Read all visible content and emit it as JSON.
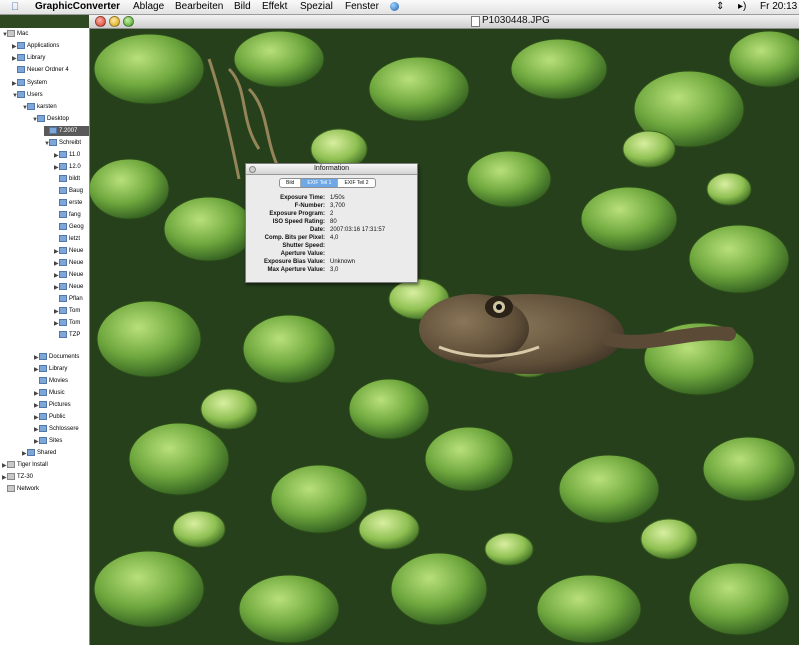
{
  "menubar": {
    "app_name": "GraphicConverter",
    "menus": [
      "Ablage",
      "Bearbeiten",
      "Bild",
      "Effekt",
      "Spezial",
      "Fenster"
    ],
    "clock": "Fr 20:13"
  },
  "window": {
    "title": "P1030448.JPG"
  },
  "sidebar": {
    "items": [
      {
        "label": "Mac"
      },
      {
        "label": "Applications"
      },
      {
        "label": "Library"
      },
      {
        "label": "Neuer Ordner 4"
      },
      {
        "label": "System"
      },
      {
        "label": "Users"
      },
      {
        "label": "karsten"
      },
      {
        "label": "Desktop"
      },
      {
        "label": "7.2007"
      },
      {
        "label": "Schreibt"
      },
      {
        "label": "11.0"
      },
      {
        "label": "12.0"
      },
      {
        "label": "bildt"
      },
      {
        "label": "Baug"
      },
      {
        "label": "erste"
      },
      {
        "label": "fang"
      },
      {
        "label": "Geog"
      },
      {
        "label": "letzt"
      },
      {
        "label": "Neue"
      },
      {
        "label": "Neue"
      },
      {
        "label": "Neue"
      },
      {
        "label": "Neue"
      },
      {
        "label": "Pflan"
      },
      {
        "label": "Tom"
      },
      {
        "label": "Tom"
      },
      {
        "label": "TZP"
      },
      {
        "label": "Documents"
      },
      {
        "label": "Library"
      },
      {
        "label": "Movies"
      },
      {
        "label": "Music"
      },
      {
        "label": "Pictures"
      },
      {
        "label": "Public"
      },
      {
        "label": "Schlossere"
      },
      {
        "label": "Sites"
      },
      {
        "label": "Shared"
      },
      {
        "label": "Tiger Install"
      },
      {
        "label": "TZ-30"
      },
      {
        "label": "Network"
      }
    ]
  },
  "info_panel": {
    "title": "Information",
    "tabs": [
      "Bild",
      "EXIF Teil 1",
      "EXIF Teil 2"
    ],
    "active_tab": "EXIF Teil 1",
    "rows": [
      {
        "key": "Exposure Time:",
        "value": "1/50s"
      },
      {
        "key": "F-Number:",
        "value": "3,700"
      },
      {
        "key": "Exposure Program:",
        "value": "2"
      },
      {
        "key": "ISO Speed Rating:",
        "value": "80"
      },
      {
        "key": "Date:",
        "value": "2007:03:16 17:31:57"
      },
      {
        "key": "Comp. Bits per Pixel:",
        "value": "4,0"
      },
      {
        "key": "Shutter Speed:",
        "value": ""
      },
      {
        "key": "Aperture Value:",
        "value": ""
      },
      {
        "key": "Exposure Bias Value:",
        "value": "Unknown"
      },
      {
        "key": "Max Aperture Value:",
        "value": "3,0"
      }
    ]
  },
  "colors": {
    "accent": "#6ea8e6",
    "leaf": "#5f9a3a",
    "water": "#233a1c",
    "frog": "#6b5a42"
  }
}
